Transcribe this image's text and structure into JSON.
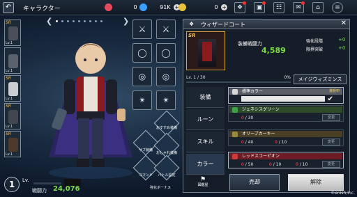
{
  "header": {
    "back": "↶",
    "title": "キャラクター",
    "currencies": [
      {
        "name": "red-gem",
        "value": "0",
        "color": "#e34b5c"
      },
      {
        "name": "blue-gem",
        "value": "91K",
        "color": "#3aa0ff"
      },
      {
        "name": "gold-coin",
        "value": "0",
        "color": "#e6c33a"
      }
    ]
  },
  "slots": [
    {
      "rarity": "SR",
      "level": "Lv.1",
      "color": "#4a4f5a"
    },
    {
      "rarity": "",
      "level": "Lv.1",
      "color": "#5a6270"
    },
    {
      "rarity": "SR",
      "level": "Lv.1",
      "color": "#c9ccd0"
    },
    {
      "rarity": "SR",
      "level": "Lv.1",
      "color": "#41464f"
    },
    {
      "rarity": "SR",
      "level": "Lv.1",
      "color": "#4e3a2a"
    }
  ],
  "character": {
    "level": "1",
    "level_label": "Lv.",
    "power_label": "戦闘力",
    "power": "24,076"
  },
  "side_menu": [
    {
      "label": "おすすめ装備"
    },
    {
      "label": "サブ装備"
    },
    {
      "label": "おしゃれ装備"
    },
    {
      "label": "コマンド"
    },
    {
      "label": "バトル設定"
    }
  ],
  "bonus_label": "強化ボーナス",
  "panel": {
    "title": "ウィザードコート",
    "item_rarity": "SR",
    "equip_power_label": "装備戦闘力",
    "equip_power": "4,589",
    "enhance_label": "強化段階",
    "enhance_value": "+0",
    "limit_label": "限界突破",
    "limit_value": "+0",
    "item_level": "Lv. 1 / 30",
    "item_percent": "0%",
    "ability_button": "メイジウィズミンス",
    "tabs": [
      "装備",
      "ルーン",
      "スキル",
      "カラー"
    ],
    "colors": [
      {
        "name": "標準カラー",
        "status": "選択中",
        "bar": "#5a5f68",
        "icon": "#d8d8d8"
      },
      {
        "name": "ジェネシスグリーン",
        "count1": "0",
        "max1": "/ 30",
        "button": "変更",
        "bar": "#2e4a2a",
        "icon": "#3ea047"
      },
      {
        "name": "オリーブカーキー",
        "count1": "0",
        "max1": "/ 40",
        "count2": "0",
        "max2": "/ 10",
        "button": "変更",
        "bar": "#4a3f24",
        "icon": "#9a8a3c"
      },
      {
        "name": "レッドスコーピオン",
        "count1": "0",
        "max1": "/ 50",
        "count2": "0",
        "max2": "/ 10",
        "count3": "0",
        "max3": "/ 10",
        "button": "変更",
        "bar": "#6b1c24",
        "icon": "#d03a3a"
      }
    ],
    "bottom_icon_label": "図鑑屋",
    "sell_button": "売却",
    "release_button": "解除"
  },
  "copyright": "©enish,Inc."
}
